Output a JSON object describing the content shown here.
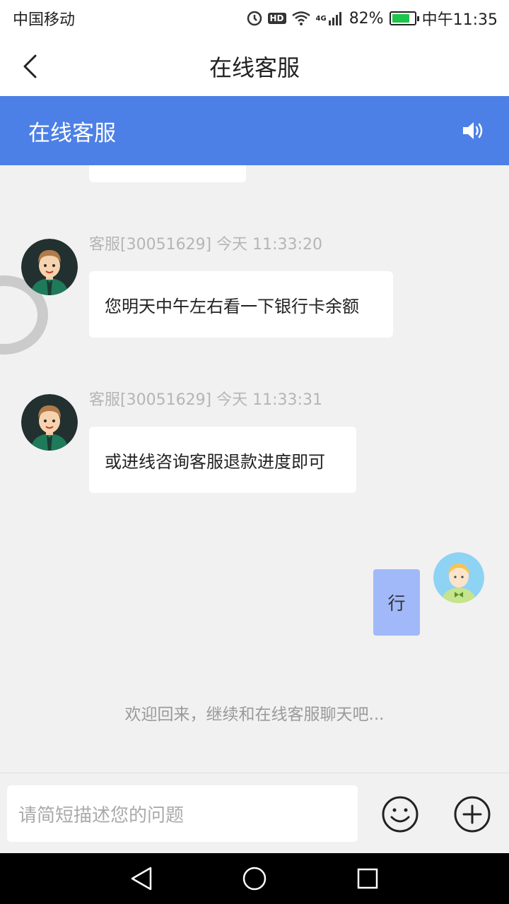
{
  "status_bar": {
    "carrier": "中国移动",
    "hd_label": "HD",
    "network": "4G",
    "battery_percent_text": "82%",
    "battery_level": 0.82,
    "time": "中午11:35"
  },
  "app_bar": {
    "title": "在线客服"
  },
  "chat_header": {
    "title": "在线客服",
    "accent_color": "#4d80e6"
  },
  "messages": [
    {
      "sender": "agent",
      "meta": "客服[30051629]  今天 11:33:20",
      "text": "您明天中午左右看一下银行卡余额"
    },
    {
      "sender": "agent",
      "meta": "客服[30051629]  今天 11:33:31",
      "text": "或进线咨询客服退款进度即可"
    },
    {
      "sender": "user",
      "text": "行"
    }
  ],
  "welcome_text": "欢迎回来，继续和在线客服聊天吧...",
  "input": {
    "placeholder": "请简短描述您的问题"
  },
  "icons": {
    "back": "chevron-left-icon",
    "speaker": "speaker-icon",
    "emoji": "smiley-icon",
    "plus": "plus-circle-icon",
    "nav_back": "triangle-back-icon",
    "nav_home": "circle-home-icon",
    "nav_recent": "square-recent-icon"
  }
}
